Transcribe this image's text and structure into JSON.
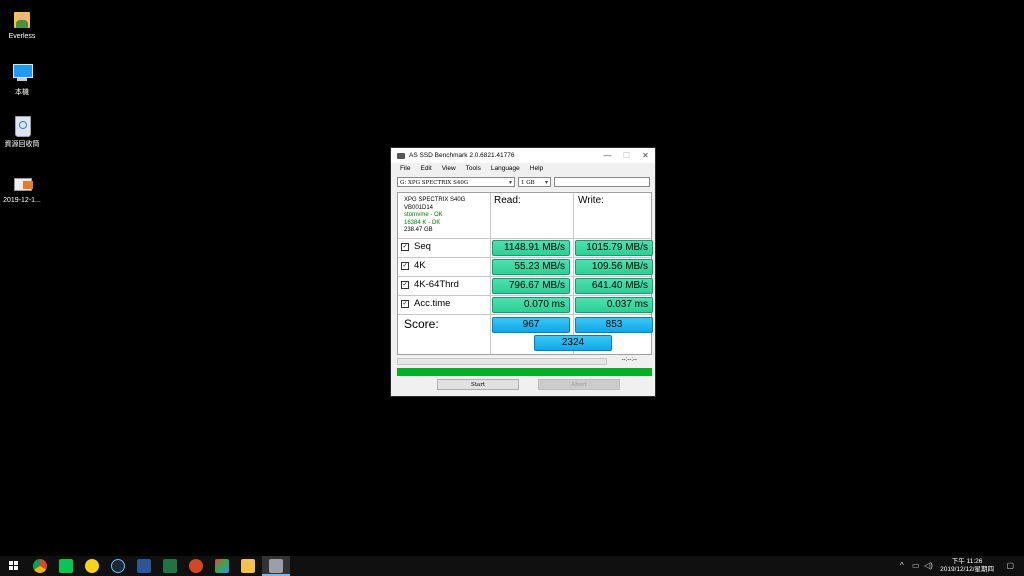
{
  "desktop": {
    "icons": [
      {
        "label": "Everless"
      },
      {
        "label": "本機"
      },
      {
        "label": "資源回收筒"
      },
      {
        "label": "2019-12-1..."
      }
    ]
  },
  "window": {
    "title": "AS SSD Benchmark 2.0.6821.41776",
    "minimize": "—",
    "maximize": "☐",
    "close": "✕",
    "menu": [
      "File",
      "Edit",
      "View",
      "Tools",
      "Language",
      "Help"
    ],
    "drive_select": "G: XPG SPECTRIX S40G",
    "size_select": "1 GB",
    "info": {
      "model": "XPG SPECTRIX S40G",
      "firmware": "VB001D14",
      "driver": "stornvme - OK",
      "alignment": "16384 K - OK",
      "capacity": "238.47 GB"
    },
    "headers": {
      "read": "Read:",
      "write": "Write:"
    },
    "rows": [
      {
        "label": "Seq",
        "read": "1148.91 MB/s",
        "write": "1015.79 MB/s"
      },
      {
        "label": "4K",
        "read": "55.23 MB/s",
        "write": "109.56 MB/s"
      },
      {
        "label": "4K-64Thrd",
        "read": "796.67 MB/s",
        "write": "641.40 MB/s"
      },
      {
        "label": "Acc.time",
        "read": "0.070 ms",
        "write": "0.037 ms"
      }
    ],
    "score": {
      "label": "Score:",
      "read": "967",
      "write": "853",
      "total": "2324"
    },
    "time_text": "--:--:--",
    "buttons": {
      "start": "Start",
      "abort": "Abort"
    }
  },
  "taskbar": {
    "clock_time": "下午 11:26",
    "clock_date": "2019/12/12/星期四",
    "icons": [
      "start",
      "chrome",
      "line",
      "potplayer",
      "steam",
      "word",
      "excel",
      "powerpoint",
      "photos",
      "explorer",
      "as-ssd"
    ]
  }
}
